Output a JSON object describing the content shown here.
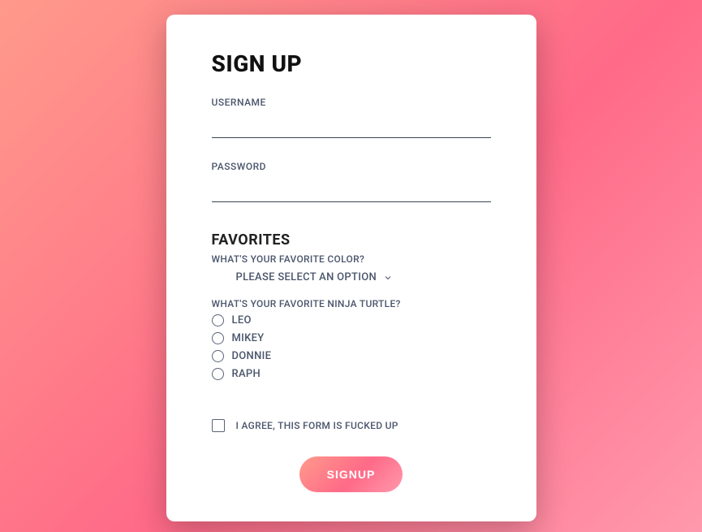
{
  "title": "SIGN UP",
  "fields": {
    "username": {
      "label": "USERNAME",
      "value": ""
    },
    "password": {
      "label": "PASSWORD",
      "value": ""
    }
  },
  "favorites": {
    "heading": "FAVORITES",
    "color_question": "WHAT'S YOUR FAVORITE COLOR?",
    "color_select_placeholder": "PLEASE SELECT AN OPTION",
    "turtle_question": "WHAT'S YOUR FAVORITE NINJA TURTLE?",
    "turtles": [
      "LEO",
      "MIKEY",
      "DONNIE",
      "RAPH"
    ]
  },
  "agree": {
    "label": "I AGREE, THIS FORM IS FUCKED UP",
    "checked": false
  },
  "submit": {
    "label": "SIGNUP"
  }
}
